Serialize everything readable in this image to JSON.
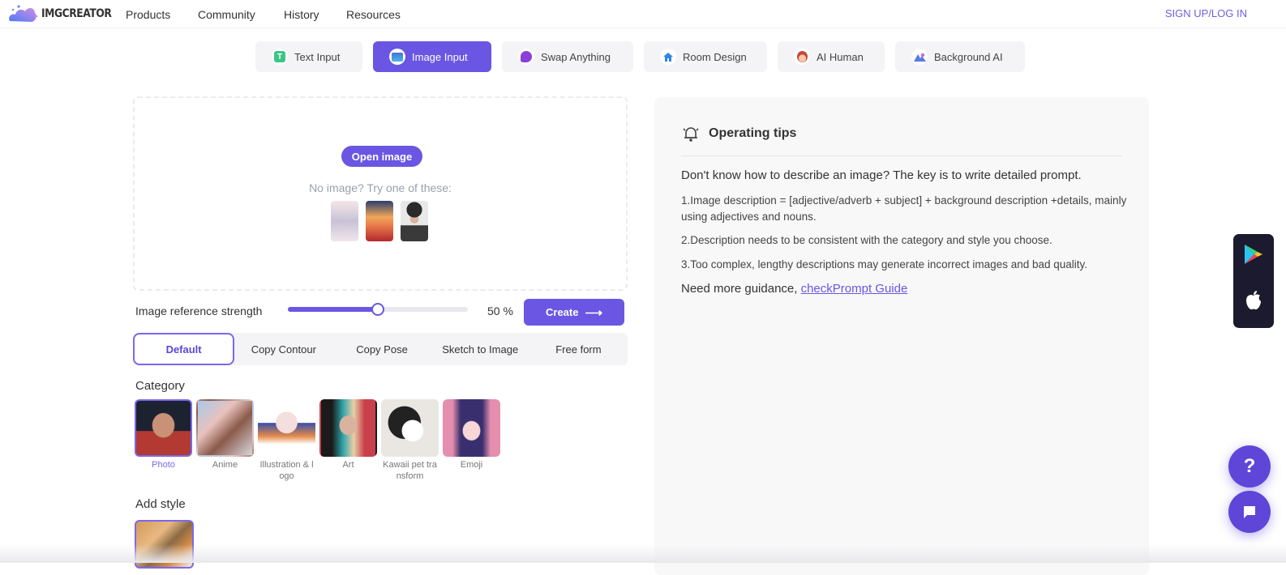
{
  "header": {
    "brand": "IMGCREATOR",
    "nav": [
      "Products",
      "Community",
      "History",
      "Resources"
    ],
    "signup": "SIGN UP/LOG IN"
  },
  "tabs": [
    {
      "label": "Text Input",
      "icon": "text-icon",
      "active": false
    },
    {
      "label": "Image Input",
      "icon": "image-icon",
      "active": true
    },
    {
      "label": "Swap Anything",
      "icon": "swap-icon",
      "active": false
    },
    {
      "label": "Room Design",
      "icon": "house-icon",
      "active": false
    },
    {
      "label": "AI Human",
      "icon": "ai-human-icon",
      "active": false
    },
    {
      "label": "Background AI",
      "icon": "background-icon",
      "active": false
    }
  ],
  "upload": {
    "open_label": "Open image",
    "try_label": "No image? Try one of these:",
    "samples": [
      "anime-girl-sketch",
      "anime-princess",
      "person-with-hat"
    ]
  },
  "strength": {
    "label": "Image reference strength",
    "value": 50,
    "value_label": "50 %"
  },
  "create_label": "Create",
  "modes": [
    {
      "label": "Default",
      "active": true
    },
    {
      "label": "Copy Contour",
      "active": false
    },
    {
      "label": "Copy Pose",
      "active": false
    },
    {
      "label": "Sketch to Image",
      "active": false
    },
    {
      "label": "Free form",
      "active": false
    }
  ],
  "category": {
    "title": "Category",
    "items": [
      {
        "label": "Photo",
        "active": true
      },
      {
        "label": "Anime",
        "active": false
      },
      {
        "label": "Illustration & logo",
        "active": false
      },
      {
        "label": "Art",
        "active": false
      },
      {
        "label": "Kawaii pet transform",
        "active": false
      },
      {
        "label": "Emoji",
        "active": false
      }
    ]
  },
  "style": {
    "title": "Add style"
  },
  "tips": {
    "title": "Operating tips",
    "main": "Don't know how to describe an image? The key is to write detailed prompt.",
    "items": [
      "1.Image description = [adjective/adverb + subject] + background description +details, mainly using adjectives and nouns.",
      "2.Description needs to be consistent with the category and style you choose.",
      "3.Too complex, lengthy descriptions may generate incorrect images and bad quality."
    ],
    "guide_prefix": "Need more guidance, ",
    "guide_link": "checkPrompt Guide"
  },
  "colors": {
    "accent": "#6a56e3",
    "store_bg": "#1b1a2e"
  }
}
